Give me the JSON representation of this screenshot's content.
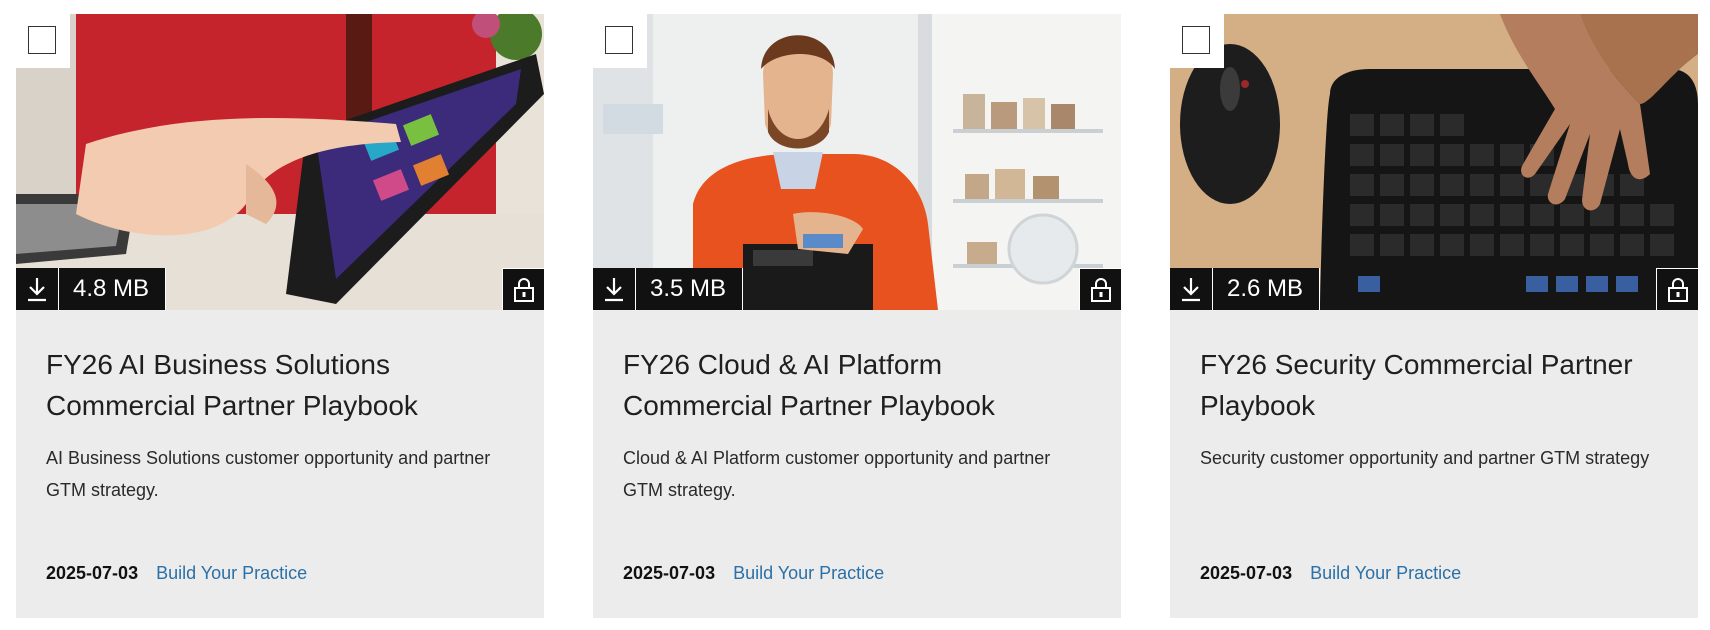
{
  "cards": [
    {
      "file_size": "4.8 MB",
      "title": "FY26 AI Business Solutions Commercial Partner Playbook",
      "description": "AI Business Solutions customer opportunity and partner GTM strategy.",
      "date": "2025-07-03",
      "category_link": "Build Your Practice",
      "image_subject": "hand tapping a tablet on a desk"
    },
    {
      "file_size": "3.5 MB",
      "title": "FY26 Cloud & AI Platform Commercial Partner Playbook",
      "description": "Cloud & AI Platform customer opportunity and partner GTM strategy.",
      "date": "2025-07-03",
      "category_link": "Build Your Practice",
      "image_subject": "man in orange sweater using a card reader in a shop"
    },
    {
      "file_size": "2.6 MB",
      "title": "FY26 Security Commercial Partner Playbook",
      "description": "Security customer opportunity and partner GTM strategy",
      "date": "2025-07-03",
      "category_link": "Build Your Practice",
      "image_subject": "hand typing on a black keyboard next to a mouse"
    }
  ],
  "icons": {
    "select": "checkbox-icon",
    "download": "download-icon",
    "lock": "lock-icon"
  },
  "colors": {
    "card_background": "#ececec",
    "link": "#2b70a6",
    "badge_background": "#111111"
  }
}
